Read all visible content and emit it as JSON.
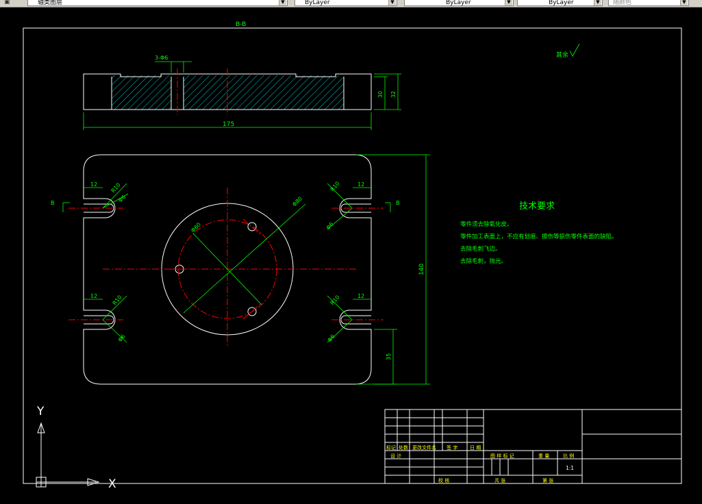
{
  "toolbar": {
    "layer_label": "轴类图层",
    "color_label": "ByLayer",
    "linetype_label": "ByLayer",
    "lineweight_label": "ByLayer",
    "plotstyle_label": "随颜色"
  },
  "drawing": {
    "section_label": "B-B",
    "surface_note": "其余",
    "dims": {
      "width_175": "175",
      "height_140": "140",
      "depth_30": "30",
      "depth_32": "32",
      "offset_35": "35",
      "slot_12_tl": "12",
      "slot_12_tr": "12",
      "slot_12_bl": "12",
      "slot_12_br": "12",
      "r10_tl": "R10",
      "r10_tr": "R10",
      "r10_bl": "R10",
      "r10_br": "R10",
      "d6_tl": "Φ6",
      "d6_tr": "Φ6",
      "d6_bl": "Φ6",
      "d6_br": "Φ6",
      "d80": "Φ80",
      "d60": "Φ60",
      "hole_callout": "3-Φ6"
    },
    "section_marks": {
      "left": "B",
      "right": "B"
    },
    "tech_req": {
      "title": "技术要求",
      "lines": [
        "零件须去除氧化皮。",
        "零件加工表面上，不应有划痕、擦伤等损伤零件表面的缺陷。",
        "去除毛刺飞边。",
        "去除毛刺，抛光。"
      ]
    },
    "title_block": {
      "mark": "标记",
      "count": "处数",
      "change_doc": "更改文件名",
      "signature": "签 字",
      "date": "日 期",
      "designer": "设 计",
      "review": "校 核",
      "stage_mark": "图 样 标 记",
      "weight": "重 量",
      "scale_label": "比 例",
      "scale_value": "1:1",
      "total": "共    张",
      "sheet": "第    张"
    },
    "ucs": {
      "x": "X",
      "y": "Y"
    }
  }
}
